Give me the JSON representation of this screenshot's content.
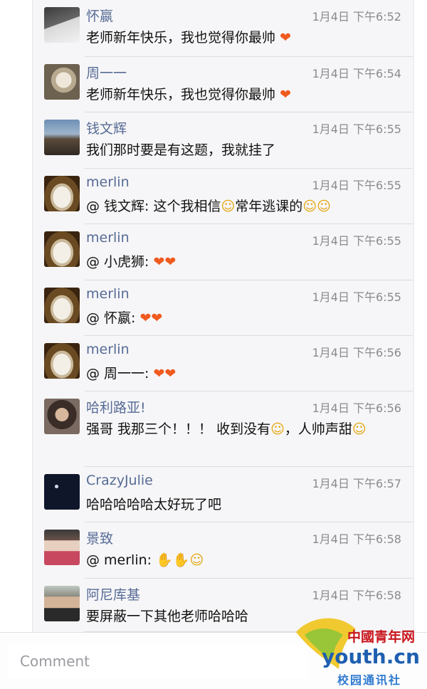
{
  "comments": [
    {
      "name": "怀嬴",
      "time": "1月4日 下午6:52",
      "text": "老师新年快乐，我也觉得你最帅",
      "emoji": "heart-emoji",
      "avatar": "avatar-dark-portrait"
    },
    {
      "name": "周一一",
      "time": "1月4日 下午6:54",
      "text": "老师新年快乐，我也觉得你最帅",
      "emoji": "heart-emoji",
      "avatar": "avatar-cat"
    },
    {
      "name": "钱文辉",
      "time": "1月4日 下午6:55",
      "text": "我们那时要是有这题，我就挂了",
      "avatar": "avatar-landscape"
    },
    {
      "name": "merlin",
      "time": "1月4日 下午6:55",
      "text": "@ 钱文辉: 这个我相信",
      "text2": "常年逃课的",
      "emoji": "thinking-face-emoji",
      "avatar": "avatar-merlin"
    },
    {
      "name": "merlin",
      "time": "1月4日 下午6:55",
      "text": "@ 小虎狮:",
      "emoji": "heart-emoji",
      "avatar": "avatar-merlin"
    },
    {
      "name": "merlin",
      "time": "1月4日 下午6:55",
      "text": "@ 怀嬴:",
      "emoji": "heart-emoji",
      "avatar": "avatar-merlin"
    },
    {
      "name": "merlin",
      "time": "1月4日 下午6:56",
      "text": "@ 周一一:",
      "emoji": "heart-emoji",
      "avatar": "avatar-merlin"
    },
    {
      "name": "哈利路亚!",
      "time": "1月4日 下午6:56",
      "text": "强哥 我那三个！！！ 收到没有",
      "text2": "，人帅声甜",
      "emoji": "grinning-face-emoji",
      "avatar": "avatar-kid"
    },
    {
      "name": "CrazyJulie",
      "time": "1月4日 下午6:57",
      "text": "哈哈哈哈哈太好玩了吧",
      "avatar": "avatar-night"
    },
    {
      "name": "景致",
      "time": "1月4日 下午6:58",
      "text": "@ merlin:",
      "emoji": "clap-emoji",
      "avatar": "avatar-child"
    },
    {
      "name": "阿尼库基",
      "time": "1月4日 下午6:58",
      "text": "要屏蔽一下其他老师哈哈哈",
      "avatar": "avatar-man"
    }
  ],
  "input": {
    "placeholder": "Comment"
  },
  "watermark": {
    "cn": "中國青年网",
    "youth": "youth.cn",
    "sub": "校园通讯社"
  },
  "colors": {
    "name": "#576b95",
    "time": "#8a8a8f",
    "heart": "#f05a1e",
    "face": "#e4a50d"
  }
}
